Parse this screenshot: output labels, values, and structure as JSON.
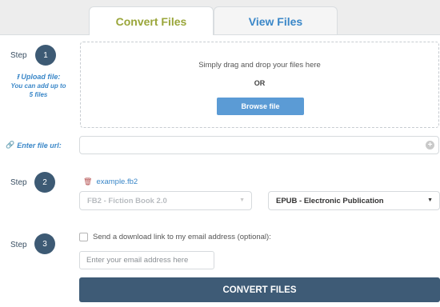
{
  "tabs": {
    "convert": "Convert Files",
    "view": "View Files"
  },
  "step1": {
    "step_label": "Step",
    "number": "1",
    "upload_title": "Upload file:",
    "upload_note_1": "You can add up to",
    "upload_note_2": "5 files",
    "drop_text": "Simply drag and drop your files here",
    "or_text": "OR",
    "browse_button": "Browse file",
    "url_label": "Enter file url:",
    "url_value": ""
  },
  "step2": {
    "step_label": "Step",
    "number": "2",
    "file_name": "example.fb2",
    "source_format": "FB2 - Fiction Book 2.0",
    "target_format": "EPUB - Electronic Publication"
  },
  "step3": {
    "step_label": "Step",
    "number": "3",
    "email_checkbox_label": "Send a download link to my email address (optional):",
    "email_placeholder": "Enter your email address here",
    "email_value": ""
  },
  "convert_button": "CONVERT FILES",
  "colors": {
    "accent_blue": "#3a87c8",
    "button_blue": "#5b9bd5",
    "dark_navy": "#3d5a74",
    "tab_green": "#9aa63a"
  }
}
